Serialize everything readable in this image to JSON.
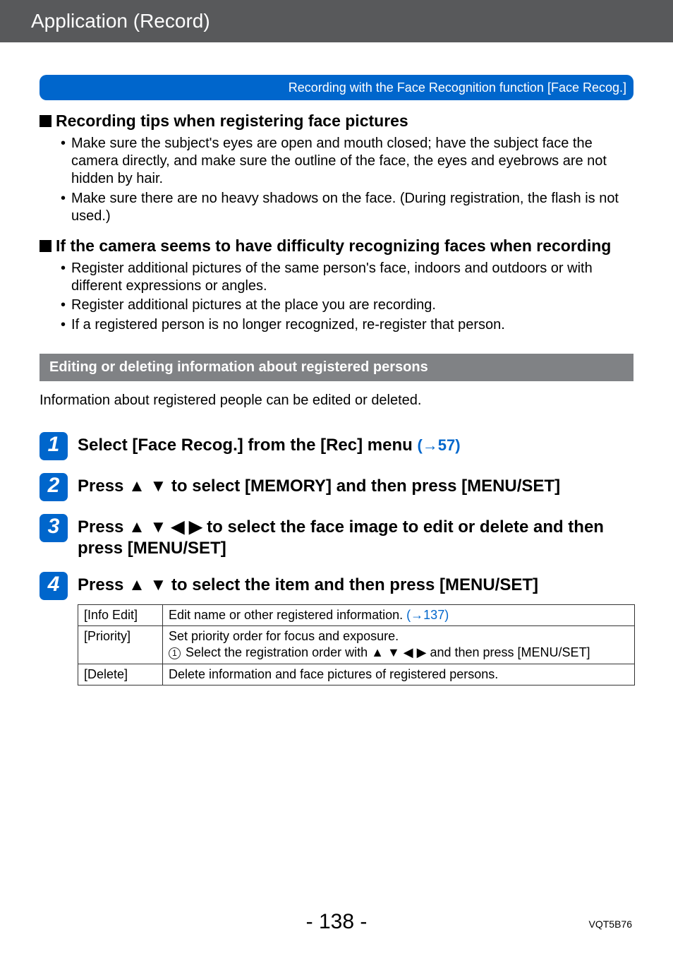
{
  "header": "Application (Record)",
  "breadcrumb": "Recording with the Face Recognition function  [Face Recog.]",
  "section1": {
    "title": "Recording tips when registering face pictures",
    "bullets": [
      "Make sure the subject's eyes are open and mouth closed; have the subject face the camera directly, and make sure the outline of the face, the eyes and eyebrows are not hidden by hair.",
      "Make sure there are no heavy shadows on the face. (During registration, the flash is not used.)"
    ]
  },
  "section2": {
    "title": "If the camera seems to have difficulty recognizing faces when recording",
    "bullets": [
      "Register additional pictures of the same person's face, indoors and outdoors or with different expressions or angles.",
      "Register additional pictures at the place you are recording.",
      "If a registered person is no longer recognized, re-register that person."
    ]
  },
  "subheading": "Editing or deleting information about registered persons",
  "subpara": "Information about registered people can be edited or deleted.",
  "steps": [
    {
      "num": "1",
      "pre": "Select [Face Recog.] from the [Rec] menu ",
      "link": "(→57)"
    },
    {
      "num": "2",
      "pre": "Press ",
      "arrows": "▲ ▼",
      "post": " to select [MEMORY] and then press [MENU/SET]"
    },
    {
      "num": "3",
      "pre": "Press ",
      "arrows": "▲ ▼ ◀ ▶",
      "post": " to select the face image to edit or delete and then press [MENU/SET]"
    },
    {
      "num": "4",
      "pre": "Press ",
      "arrows": "▲ ▼",
      "post": " to select the item and then press [MENU/SET]"
    }
  ],
  "table": {
    "rows": [
      {
        "label": "[Info Edit]",
        "desc": "Edit name or other registered information. ",
        "link": "(→137)"
      },
      {
        "label": "[Priority]",
        "desc_line1": "Set priority order for focus and exposure.",
        "desc_line2_pre": " Select the registration order with ",
        "arrows": "▲ ▼ ◀ ▶",
        "desc_line2_post": " and then press [MENU/SET]"
      },
      {
        "label": "[Delete]",
        "desc": "Delete information and face pictures of registered persons."
      }
    ]
  },
  "page_number": "- 138 -",
  "doc_code": "VQT5B76"
}
